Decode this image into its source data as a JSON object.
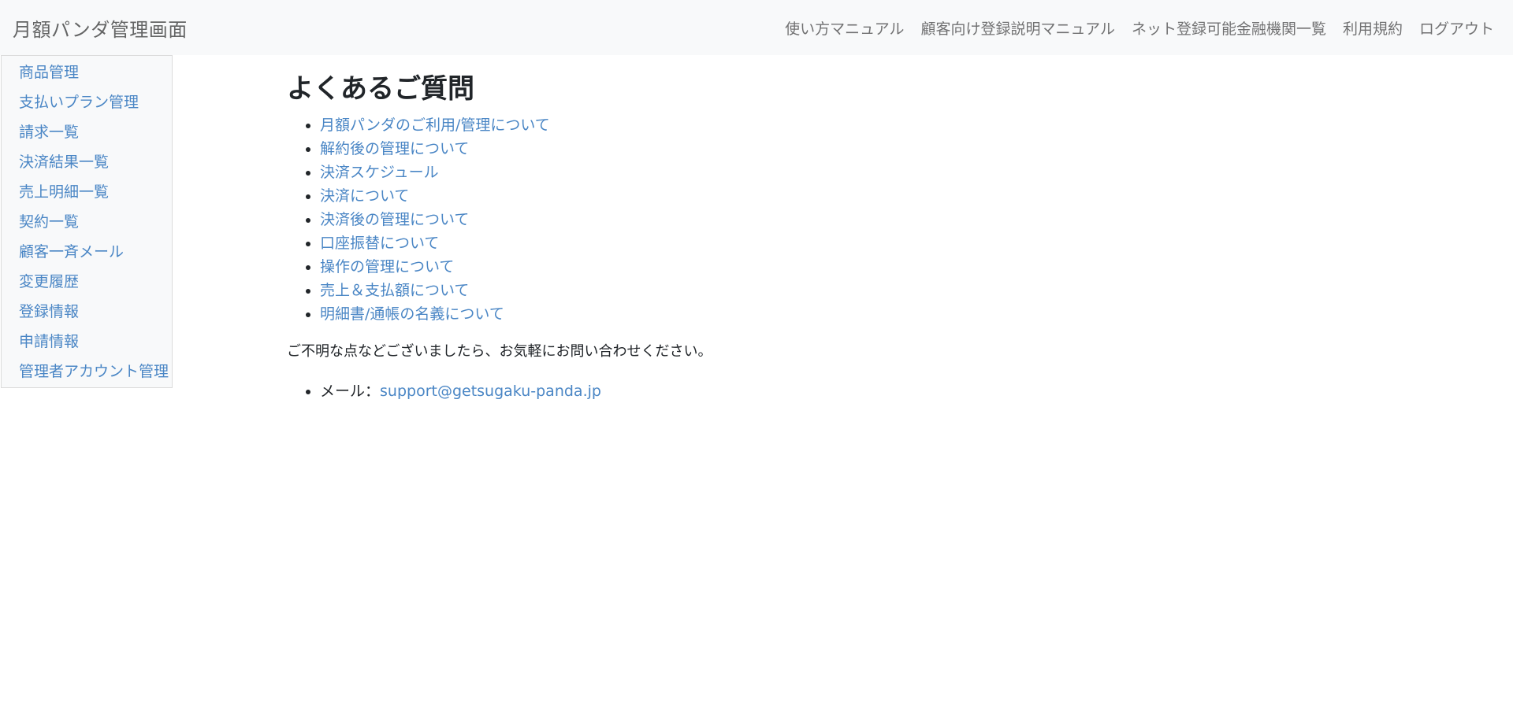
{
  "header": {
    "brand": "月額パンダ管理画面",
    "links": [
      {
        "label": "使い方マニュアル"
      },
      {
        "label": "顧客向け登録説明マニュアル"
      },
      {
        "label": "ネット登録可能金融機関一覧"
      },
      {
        "label": "利用規約"
      },
      {
        "label": "ログアウト"
      }
    ]
  },
  "sidebar": {
    "items": [
      {
        "label": "商品管理"
      },
      {
        "label": "支払いプラン管理"
      },
      {
        "label": "請求一覧"
      },
      {
        "label": "決済結果一覧"
      },
      {
        "label": "売上明細一覧"
      },
      {
        "label": "契約一覧"
      },
      {
        "label": "顧客一斉メール"
      },
      {
        "label": "変更履歴"
      },
      {
        "label": "登録情報"
      },
      {
        "label": "申請情報"
      },
      {
        "label": "管理者アカウント管理"
      }
    ]
  },
  "main": {
    "title": "よくあるご質問",
    "faq": [
      {
        "label": "月額パンダのご利用/管理について"
      },
      {
        "label": "解約後の管理について"
      },
      {
        "label": "決済スケジュール"
      },
      {
        "label": "決済について"
      },
      {
        "label": "決済後の管理について"
      },
      {
        "label": "口座振替について"
      },
      {
        "label": "操作の管理について"
      },
      {
        "label": "売上＆支払額について"
      },
      {
        "label": "明細書/通帳の名義について"
      }
    ],
    "contact_text": "ご不明な点などございましたら、お気軽にお問い合わせください。",
    "contact_mail_label": "メール：",
    "contact_mail": "support@getsugaku-panda.jp"
  },
  "colors": {
    "link": "#4a86c5",
    "navbar_bg": "#f8f9fa"
  }
}
